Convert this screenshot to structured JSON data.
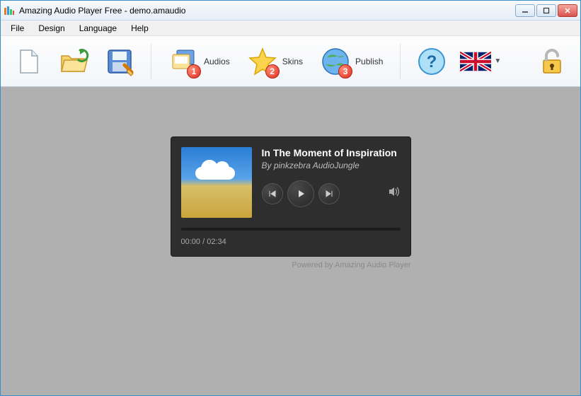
{
  "window": {
    "title": "Amazing Audio Player Free - demo.amaudio"
  },
  "menu": {
    "file": "File",
    "design": "Design",
    "language": "Language",
    "help": "Help"
  },
  "toolbar": {
    "audios_label": "Audios",
    "audios_badge": "1",
    "skins_label": "Skins",
    "skins_badge": "2",
    "publish_label": "Publish",
    "publish_badge": "3"
  },
  "player": {
    "title": "In The Moment of Inspiration",
    "artist": "By pinkzebra AudioJungle",
    "time": "00:00 / 02:34",
    "credit": "Powered by Amazing Audio Player"
  }
}
